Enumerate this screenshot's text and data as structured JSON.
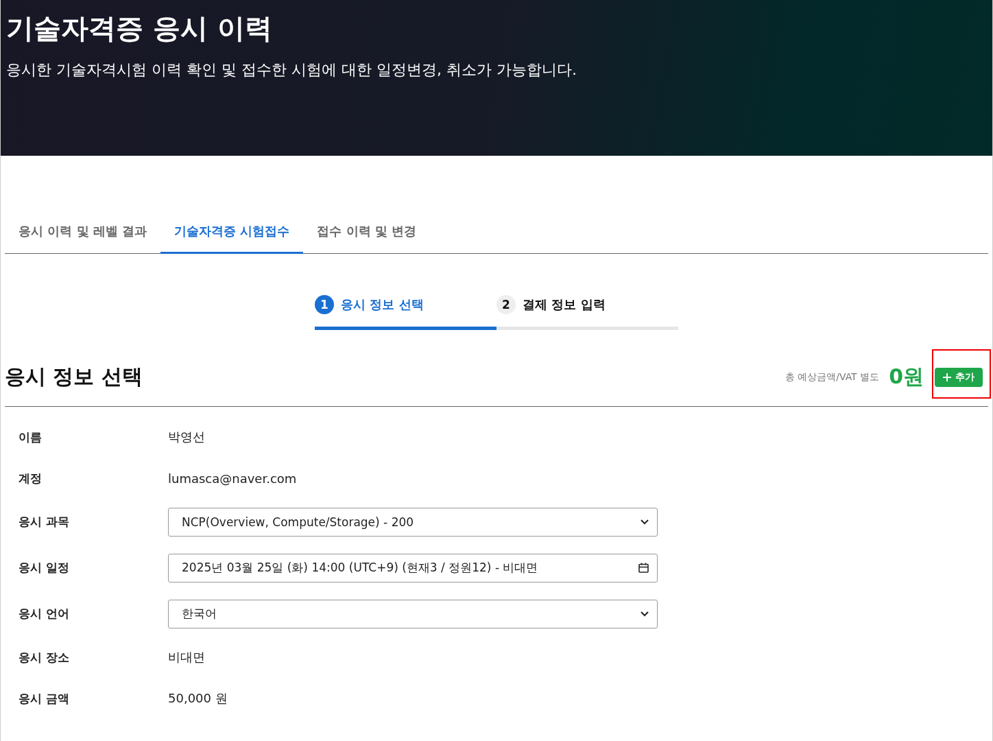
{
  "header": {
    "title": "기술자격증 응시 이력",
    "subtitle": "응시한 기술자격시험 이력 확인 및 접수한 시험에 대한 일정변경, 취소가 가능합니다."
  },
  "tabs": [
    {
      "label": "응시 이력 및 레벨 결과",
      "selected": false
    },
    {
      "label": "기술자격증 시험접수",
      "selected": true
    },
    {
      "label": "접수 이력 및 변경",
      "selected": false
    }
  ],
  "steps": [
    {
      "number": "1",
      "label": "응시 정보 선택",
      "selected": true
    },
    {
      "number": "2",
      "label": "결제 정보 입력",
      "selected": false
    }
  ],
  "section": {
    "title": "응시 정보 선택",
    "total_label": "총 예상금액/VAT 별도",
    "total_value": "0원",
    "add_button": {
      "label": "추가",
      "highlighted": true
    }
  },
  "fields": [
    {
      "kind": "text",
      "label": "이름",
      "value": "박영선"
    },
    {
      "kind": "text",
      "label": "계정",
      "value": "lumasca@naver.com"
    },
    {
      "kind": "select",
      "label": "응시 과목",
      "value": "NCP(Overview, Compute/Storage) - 200"
    },
    {
      "kind": "date",
      "label": "응시 일정",
      "value": "2025년 03월 25일 (화) 14:00 (UTC+9) (현재3 / 정원12) - 비대면"
    },
    {
      "kind": "select",
      "label": "응시 언어",
      "value": "한국어"
    },
    {
      "kind": "text",
      "label": "응시 장소",
      "value": "비대면"
    },
    {
      "kind": "text",
      "label": "응시 금액",
      "value": "50,000 원"
    }
  ]
}
